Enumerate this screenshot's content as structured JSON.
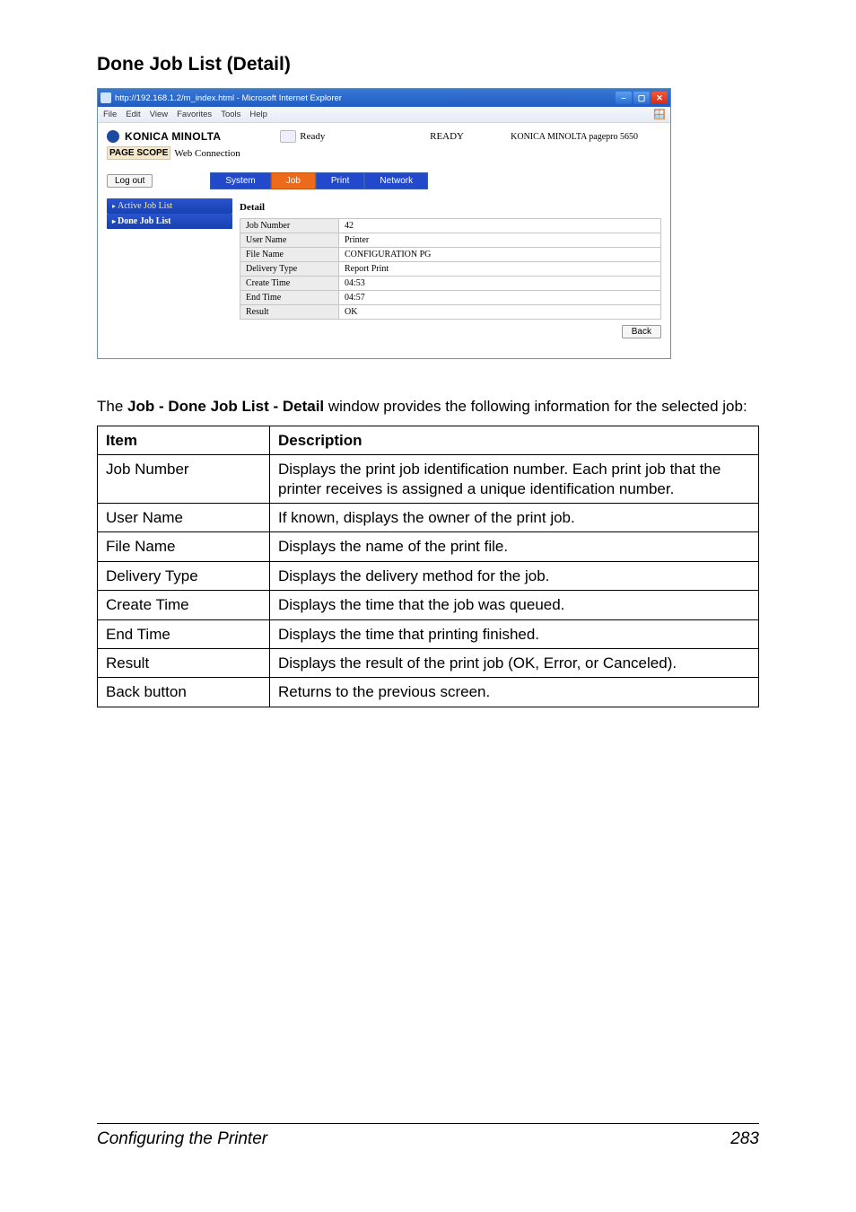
{
  "section": {
    "title": "Done Job List (Detail)"
  },
  "browser": {
    "title": "http://192.168.1.2/m_index.html - Microsoft Internet Explorer",
    "menus": [
      "File",
      "Edit",
      "View",
      "Favorites",
      "Tools",
      "Help"
    ],
    "brand": "KONICA MINOLTA",
    "subbrand_prefix": "PAGE SCOPE",
    "subbrand": "Web Connection",
    "status_small": "Ready",
    "status_big": "READY",
    "model": "KONICA MINOLTA pagepro 5650",
    "logout": "Log out",
    "tabs": [
      "System",
      "Job",
      "Print",
      "Network"
    ],
    "sidebar": {
      "active": "Active Job List",
      "done": "Done Job List"
    },
    "panel_title": "Detail",
    "details": [
      {
        "k": "Job Number",
        "v": "42"
      },
      {
        "k": "User Name",
        "v": "Printer"
      },
      {
        "k": "File Name",
        "v": "CONFIGURATION PG"
      },
      {
        "k": "Delivery Type",
        "v": "Report Print"
      },
      {
        "k": "Create Time",
        "v": "04:53"
      },
      {
        "k": "End Time",
        "v": "04:57"
      },
      {
        "k": "Result",
        "v": "OK"
      }
    ],
    "back": "Back"
  },
  "desc": {
    "pre": "The ",
    "bold": "Job - Done Job List - Detail",
    "post": " window provides the following information for the selected job:"
  },
  "info": {
    "head_item": "Item",
    "head_desc": "Description",
    "rows": [
      {
        "item": "Job Number",
        "desc": "Displays the print job identification number. Each print job that the printer receives is assigned a unique identification number."
      },
      {
        "item": "User Name",
        "desc": "If known, displays the owner of the print job."
      },
      {
        "item": "File Name",
        "desc": "Displays the name of the print file."
      },
      {
        "item": "Delivery Type",
        "desc": "Displays the delivery method for the job."
      },
      {
        "item": "Create Time",
        "desc": "Displays the time that the job was queued."
      },
      {
        "item": "End Time",
        "desc": "Displays the time that printing finished."
      },
      {
        "item": "Result",
        "desc": "Displays the result of the print job (OK, Error, or Canceled)."
      },
      {
        "item": "Back button",
        "desc": "Returns to the previous screen."
      }
    ]
  },
  "footer": {
    "text": "Configuring the Printer",
    "page": "283"
  }
}
